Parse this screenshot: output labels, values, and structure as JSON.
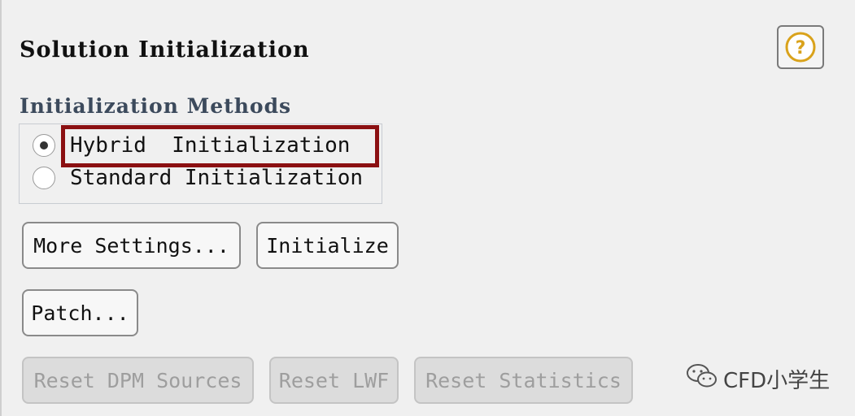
{
  "panel": {
    "title": "Solution Initialization",
    "help_icon": "question-circle-icon",
    "accent_color": "#d9a21b"
  },
  "methods": {
    "group_label": "Initialization Methods",
    "options": [
      {
        "label": "Hybrid  Initialization",
        "checked": true
      },
      {
        "label": "Standard Initialization",
        "checked": false
      }
    ],
    "highlight_color": "#8b1012"
  },
  "buttons": {
    "more_settings": "More Settings...",
    "initialize": "Initialize",
    "patch": "Patch...",
    "reset_dpm_sources": "Reset DPM Sources",
    "reset_lwf": "Reset LWF",
    "reset_statistics": "Reset Statistics"
  },
  "watermark": {
    "text": "CFD小学生",
    "icon": "wechat-icon"
  }
}
